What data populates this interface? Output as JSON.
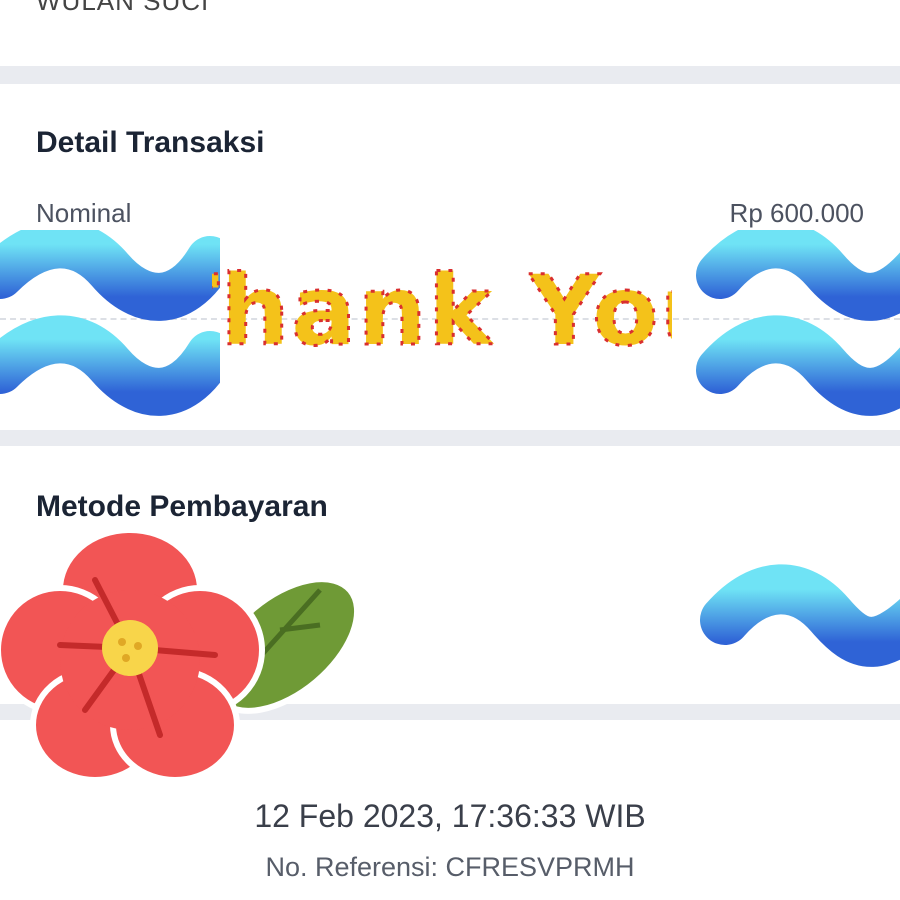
{
  "header": {
    "name": "WULAN SUCI"
  },
  "detail": {
    "title": "Detail Transaksi",
    "nominal_label": "Nominal",
    "nominal_value": "Rp 600.000"
  },
  "stickers": {
    "thank_you_text": "Thank You",
    "squiggle_color": "#4fc3f7",
    "flower_color": "#f25555",
    "leaf_color": "#6f9a36"
  },
  "payment": {
    "title": "Metode Pembayaran"
  },
  "footer": {
    "timestamp": "12 Feb 2023, 17:36:33 WIB",
    "reference": "No. Referensi: CFRESVPRMH"
  }
}
